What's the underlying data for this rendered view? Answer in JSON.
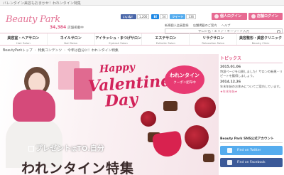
{
  "topbar": {
    "tagline": "バレンタイン美容もおまかせ！われンタイン特集"
  },
  "header": {
    "logo": "Beauty Park",
    "count_value": "34,384",
    "count_unit": "店舗掲載中",
    "social": {
      "like_label": "いいね！",
      "like_count": "1,206",
      "hatena_label": "B!",
      "hatena_count": "54",
      "tweet_label": "ツイート",
      "tweet_count": "136"
    },
    "member_buttons": [
      "個人ログイン",
      "店舗ログイン"
    ],
    "sublinks": [
      "新規個人会員登録",
      "店舗掲載のご案内",
      "ヘルプ"
    ],
    "search_placeholder": "サロン名・エリア・キーワード入力"
  },
  "nav": [
    {
      "jp": "美容室・ヘアサロン",
      "en": "Hair Salon"
    },
    {
      "jp": "ネイルサロン",
      "en": "Nail Salon"
    },
    {
      "jp": "アイラッシュ・まつげサロン",
      "en": "Eyelash Salon"
    },
    {
      "jp": "エステサロン",
      "en": "Esthetic Salon"
    },
    {
      "jp": "リラクサロン",
      "en": "Relaxation Salon"
    },
    {
      "jp": "美容整形・美容クリニック",
      "en": "Beauty Clinic"
    }
  ],
  "breadcrumb": [
    "BeautyParkトップ",
    "特集コンテンツ",
    "今年は自分に！われンタイン特集"
  ],
  "banner": {
    "happy": "Happy",
    "valentines": "Valentine's",
    "day": "Day",
    "coupon_line1": "われンタイン",
    "coupon_line2": "クーポン配布中",
    "present_prefix": "プレゼント",
    "present_middle": "は",
    "present_suffix": "TO.自分",
    "feature_title": "われンタイン特集"
  },
  "topics": {
    "heading": "トピックス",
    "items": [
      {
        "date": "2015.01.06",
        "text": "特設ページを公開しました！サロンの新規・リピートを獲得しましょう。",
        "highlight": ""
      },
      {
        "date": "2014.12.26",
        "text": "年末年始のお休みについてご案内しています。",
        "highlight": "★年末年始★"
      }
    ]
  },
  "sns": {
    "heading": "Beauty Park SNS公式アカウント",
    "twitter_label": "Find on Twitter",
    "facebook_label": "Find on Facebook"
  },
  "colors": {
    "accent": "#e05a85",
    "valentine_red": "#d2235a",
    "facebook": "#3b5998",
    "twitter": "#55acee"
  }
}
